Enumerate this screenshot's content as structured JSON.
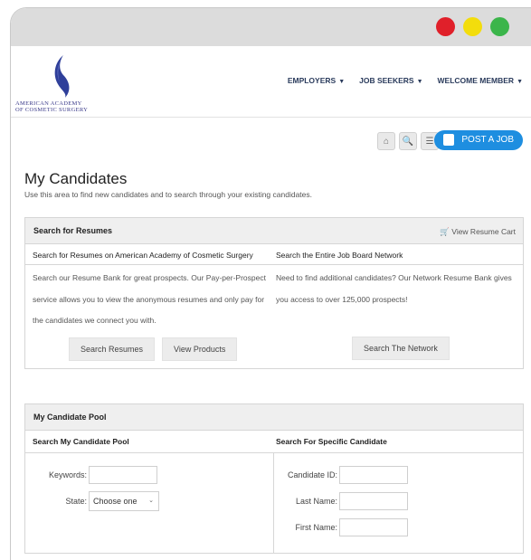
{
  "window": {
    "controls": [
      "close",
      "minimize",
      "maximize"
    ]
  },
  "brand": {
    "logo_line1": "American Academy",
    "logo_line2": "of Cosmetic Surgery",
    "logo_color": "#3a3a8a"
  },
  "nav": {
    "employers": "EMPLOYERS",
    "job_seekers": "JOB SEEKERS",
    "welcome": "WELCOME MEMBER"
  },
  "toolbar": {
    "post_job": "POST A JOB",
    "icons": [
      "home-icon",
      "search-doc-icon",
      "list-icon",
      "post-job-icon"
    ],
    "accent": "#1e8ee0"
  },
  "page": {
    "title": "My Candidates",
    "subtitle": "Use this area to find new candidates and to search through your existing candidates."
  },
  "resume_panel": {
    "title": "Search for Resumes",
    "cart_link": "View Resume Cart",
    "left_heading": "Search for Resumes on American Academy of Cosmetic Surgery",
    "right_heading": "Search the Entire Job Board Network",
    "left_desc": "Search our Resume Bank for great prospects. Our Pay-per-Prospect service allows you to view the anonymous resumes and only pay for the candidates we connect you with.",
    "right_desc": "Need to find additional candidates? Our Network Resume Bank gives you access to over 125,000 prospects!",
    "btn_search_resumes": "Search Resumes",
    "btn_view_products": "View Products",
    "btn_search_network": "Search The Network"
  },
  "pool_panel": {
    "title": "My Candidate Pool",
    "left_heading": "Search My Candidate Pool",
    "right_heading": "Search For Specific Candidate",
    "keywords_label": "Keywords:",
    "state_label": "State:",
    "state_value": "Choose one",
    "candidate_id_label": "Candidate ID:",
    "last_name_label": "Last Name:",
    "first_name_label": "First Name:"
  }
}
